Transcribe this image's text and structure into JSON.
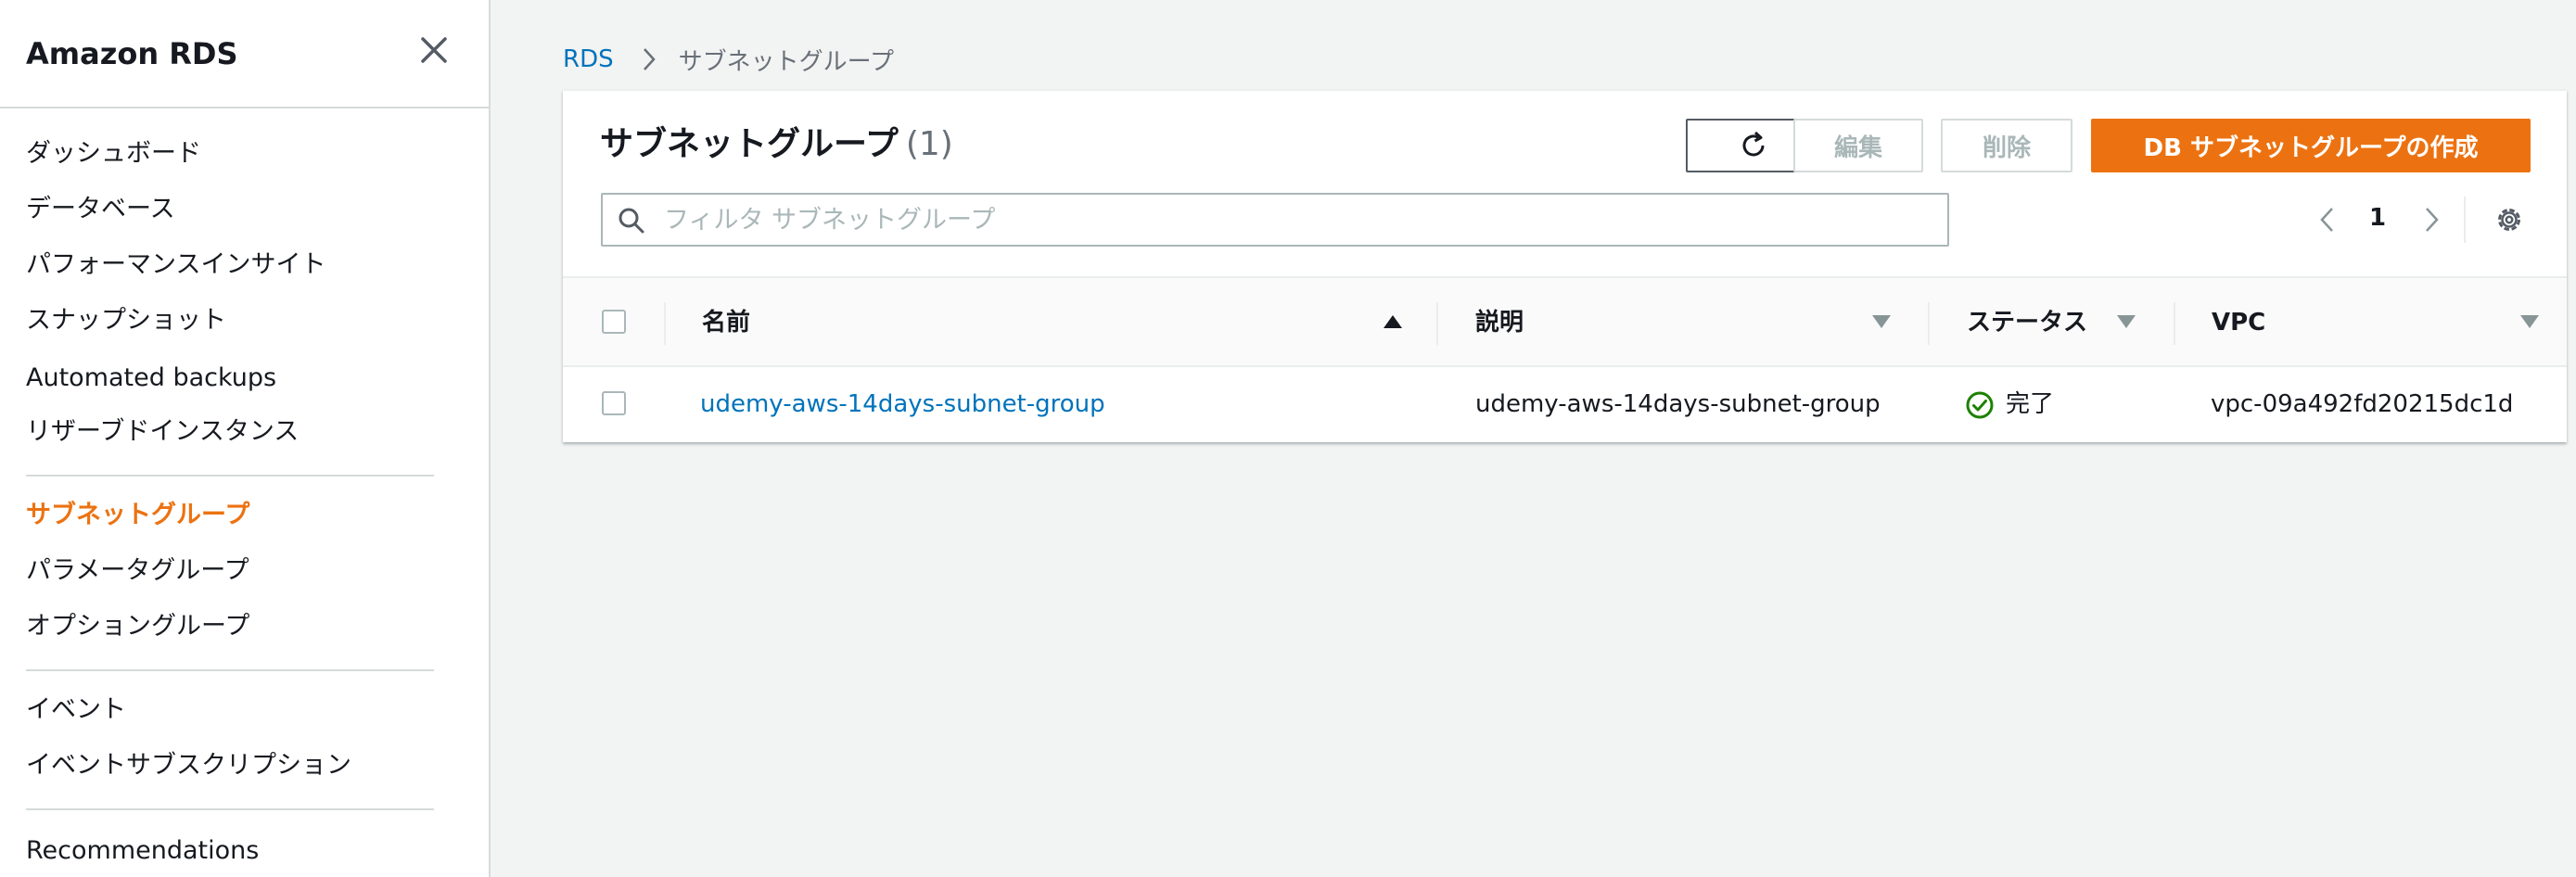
{
  "sidebar": {
    "title": "Amazon RDS",
    "items": [
      {
        "label": "ダッシュボード"
      },
      {
        "label": "データベース"
      },
      {
        "label": "パフォーマンスインサイト"
      },
      {
        "label": "スナップショット"
      },
      {
        "label": "Automated backups"
      },
      {
        "label": "リザーブドインスタンス"
      },
      {
        "label": "サブネットグループ",
        "active": true
      },
      {
        "label": "パラメータグループ"
      },
      {
        "label": "オプショングループ"
      },
      {
        "label": "イベント"
      },
      {
        "label": "イベントサブスクリプション"
      },
      {
        "label": "Recommendations"
      }
    ]
  },
  "breadcrumb": {
    "root": "RDS",
    "current": "サブネットグループ"
  },
  "panel": {
    "title": "サブネットグループ",
    "count": "(1)",
    "buttons": {
      "edit": "編集",
      "delete": "削除",
      "create": "DB サブネットグループの作成"
    },
    "search": {
      "placeholder": "フィルタ サブネットグループ",
      "value": ""
    },
    "pagination": {
      "current_page": "1"
    }
  },
  "table": {
    "columns": [
      {
        "label": "名前",
        "sort": "ascending"
      },
      {
        "label": "説明",
        "sort": "none"
      },
      {
        "label": "ステータス",
        "sort": "none"
      },
      {
        "label": "VPC",
        "sort": "none"
      }
    ],
    "rows": [
      {
        "name": "udemy-aws-14days-subnet-group",
        "description": "udemy-aws-14days-subnet-group",
        "status": "完了",
        "vpc": "vpc-09a492fd20215dc1d"
      }
    ]
  },
  "colors": {
    "accent": "#ec7211",
    "link": "#0073bb",
    "success": "#1d8102",
    "background": "#f2f3f3"
  }
}
